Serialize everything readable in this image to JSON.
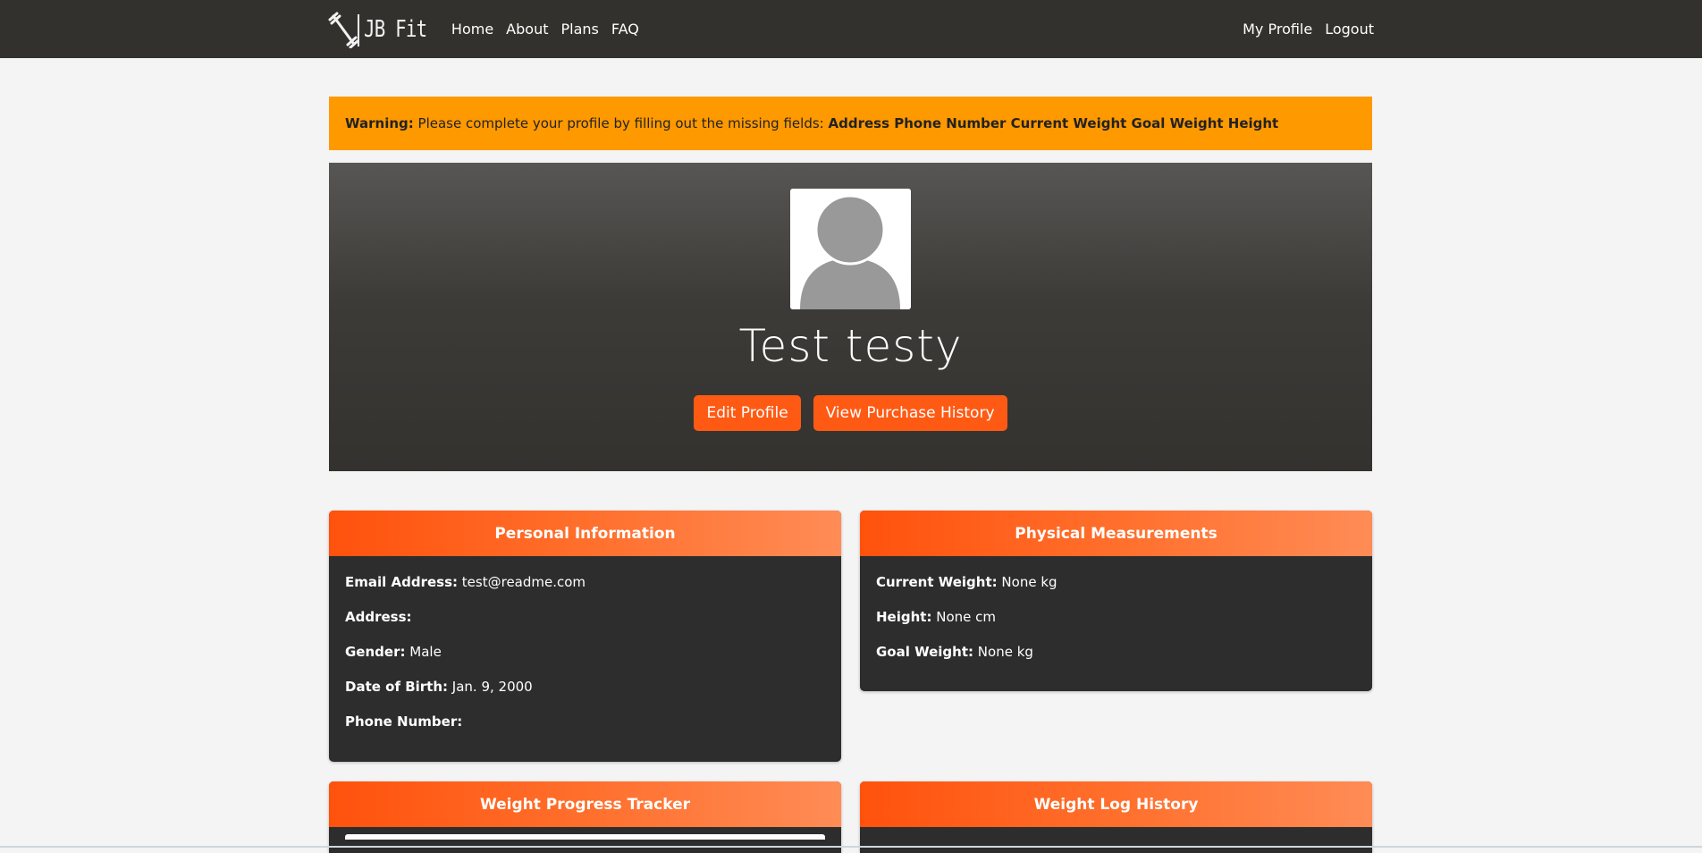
{
  "nav": {
    "brand": "JB Fit",
    "links": [
      "Home",
      "About",
      "Plans",
      "FAQ"
    ],
    "right_links": [
      "My Profile",
      "Logout"
    ]
  },
  "warning": {
    "label": "Warning:",
    "message": "Please complete your profile by filling out the missing fields:",
    "fields": "Address Phone Number Current Weight Goal Weight Height"
  },
  "profile": {
    "name": "Test testy",
    "edit_button": "Edit Profile",
    "history_button": "View Purchase History"
  },
  "personal": {
    "title": "Personal Information",
    "rows": [
      {
        "label": "Email Address:",
        "value": "test@readme.com"
      },
      {
        "label": "Address:",
        "value": ""
      },
      {
        "label": "Gender:",
        "value": "Male"
      },
      {
        "label": "Date of Birth:",
        "value": "Jan. 9, 2000"
      },
      {
        "label": "Phone Number:",
        "value": ""
      }
    ]
  },
  "physical": {
    "title": "Physical Measurements",
    "rows": [
      {
        "label": "Current Weight:",
        "value": "None kg"
      },
      {
        "label": "Height:",
        "value": "None cm"
      },
      {
        "label": "Goal Weight:",
        "value": "None kg"
      }
    ]
  },
  "tracker": {
    "title": "Weight Progress Tracker"
  },
  "log": {
    "title": "Weight Log History"
  },
  "colors": {
    "navbar": "#33312e",
    "accent": "#ff5a14",
    "warning": "#ff9900",
    "card": "#2d2d2d"
  }
}
